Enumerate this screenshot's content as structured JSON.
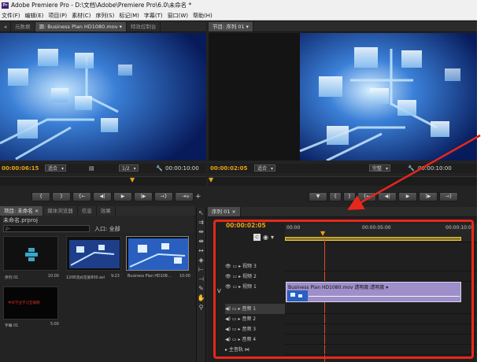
{
  "window": {
    "title": "Adobe Premiere Pro - D:\\文档\\Adobe\\Premiere Pro\\6.0\\未命名 *",
    "icon": "Pr"
  },
  "menu": [
    "文件(F)",
    "编辑(E)",
    "项目(P)",
    "素材(C)",
    "序列(S)",
    "标记(M)",
    "字幕(T)",
    "窗口(W)",
    "帮助(H)"
  ],
  "source_monitor": {
    "tabs": [
      "元数据",
      "源: Business Plan HD1080.mov ▾",
      "特效控制台"
    ],
    "timecode_in": "00:00:06:15",
    "fit": "适合",
    "resolution": "1/2",
    "timecode_out": "00:00:10:00"
  },
  "program_monitor": {
    "tab": "节目: 序列 01 ▾",
    "timecode_in": "00:00:02:05",
    "fit": "适合",
    "resolution": "完整",
    "timecode_out": "00:00:10:00"
  },
  "project": {
    "tabs": [
      "项目: 未命名 ×",
      "媒体浏览器",
      "信息",
      "效果"
    ],
    "file": "未命名.prproj",
    "search_placeholder": "ρ-",
    "entry_label": "入口: 全部",
    "items": [
      {
        "name": "序列 01",
        "duration": "10:00"
      },
      {
        "name": "1208流式花絮800.avi",
        "duration": "9:23"
      },
      {
        "name": "Business Plan HD108...",
        "duration": "10:00"
      },
      {
        "name": "字幕 01",
        "duration": "5:00"
      }
    ],
    "title_thumb_text": "中华学业学习互联网"
  },
  "timeline": {
    "tab": "序列 01 ×",
    "timecode": "00:00:02:05",
    "ruler_labels": [
      "00:00",
      "00:00:05:00",
      "00:00:10:00"
    ],
    "tracks": [
      {
        "name": "视频 3",
        "kind": "video"
      },
      {
        "name": "视频 2",
        "kind": "video"
      },
      {
        "name": "视频 1",
        "kind": "video"
      },
      {
        "name": "音频 1",
        "kind": "audio"
      },
      {
        "name": "音频 2",
        "kind": "audio"
      },
      {
        "name": "音频 3",
        "kind": "audio"
      },
      {
        "name": "音频 4",
        "kind": "audio"
      },
      {
        "name": "主音轨",
        "kind": "master"
      }
    ],
    "v_label": "V",
    "clip_label": "Business Plan HD1080.mov 透明度:透明度 ▾"
  },
  "colors": {
    "accent_timecode": "#e8a317",
    "clip": "#9e8ec9",
    "highlight": "#e8271b"
  }
}
